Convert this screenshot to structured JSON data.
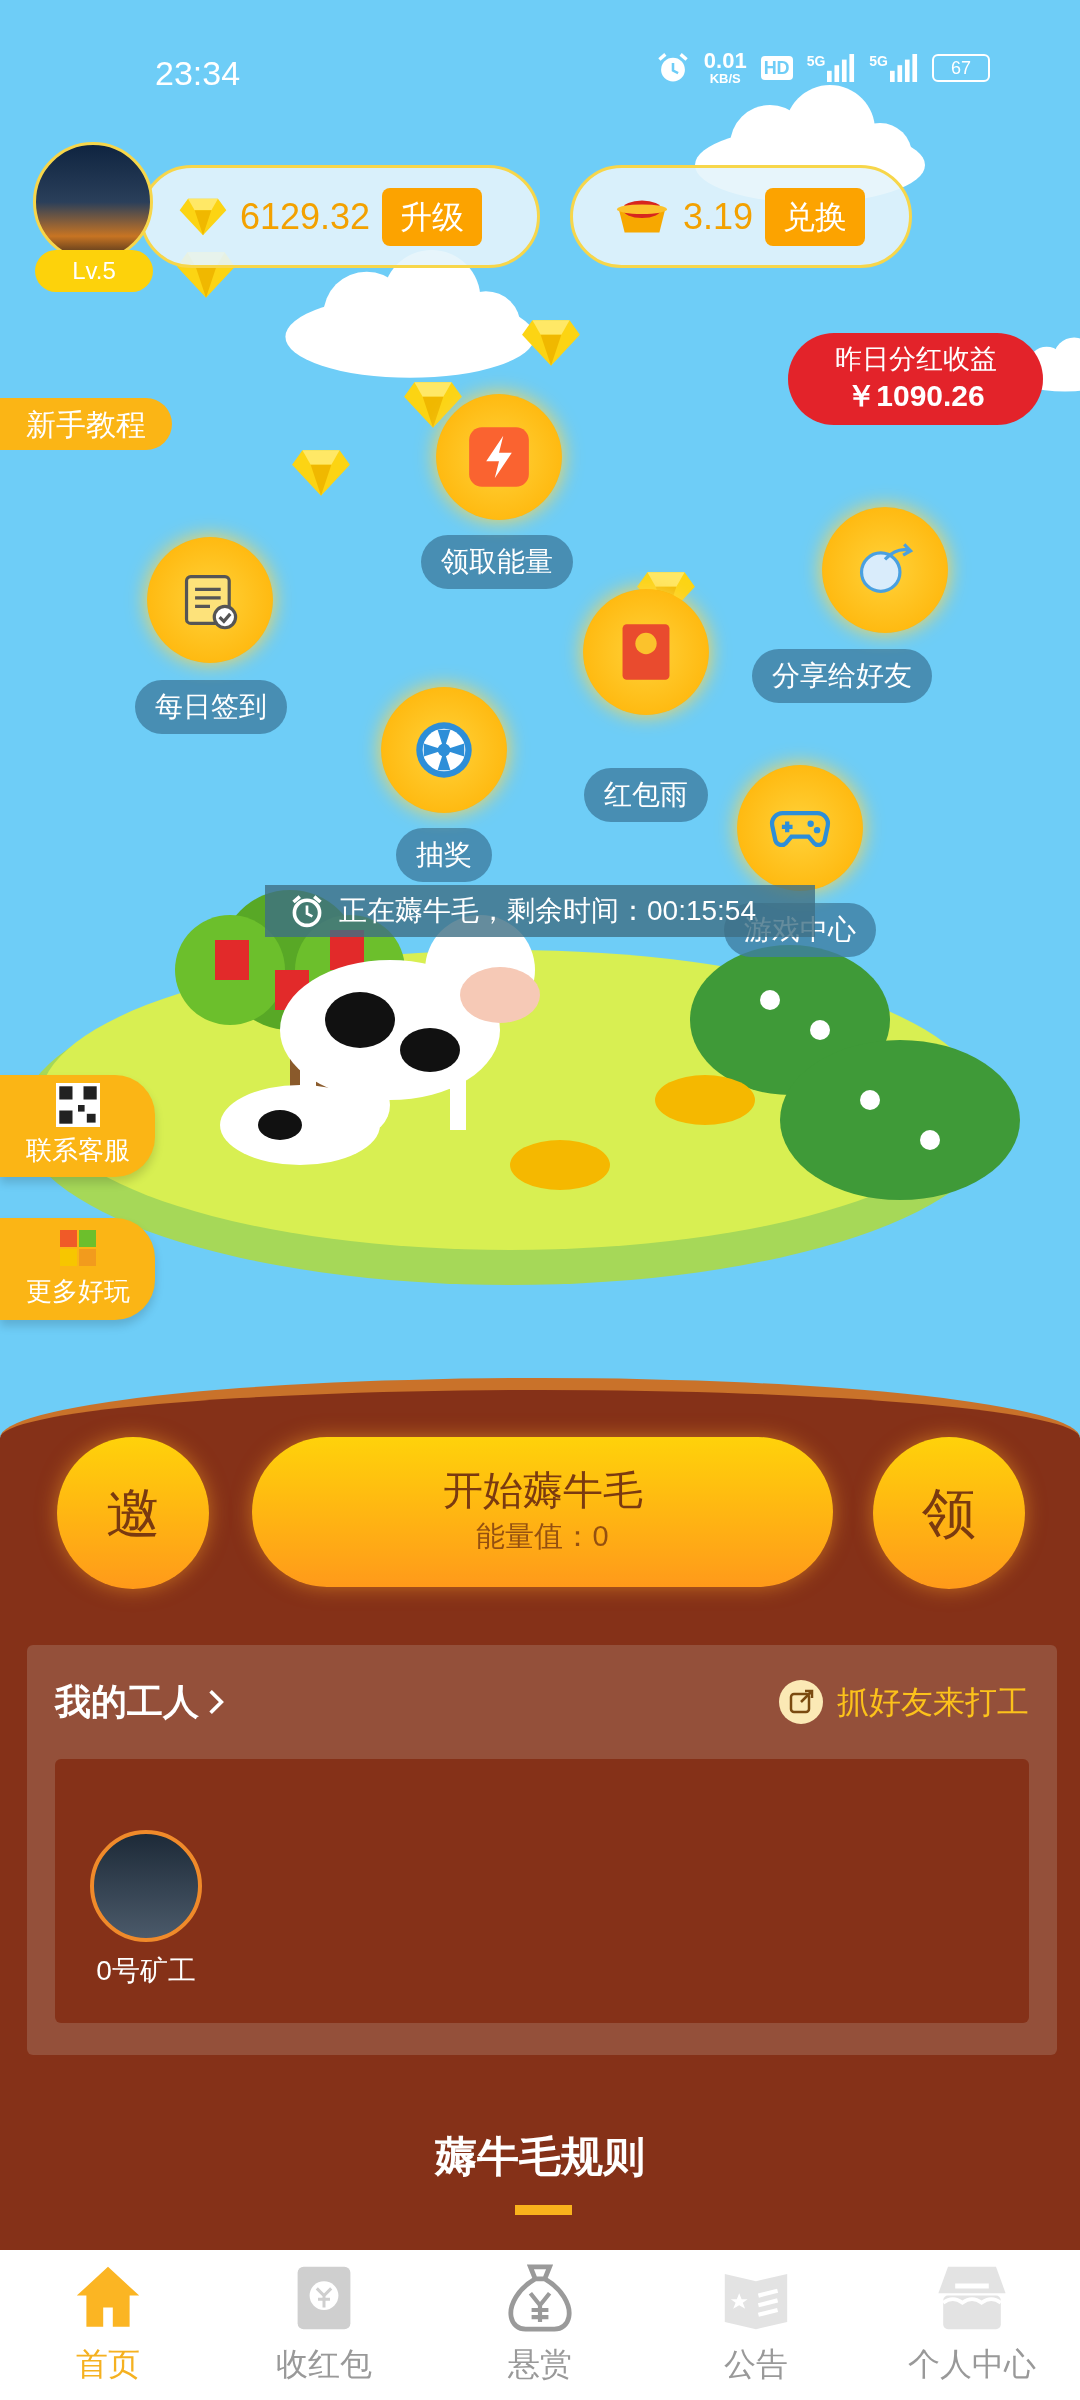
{
  "status_bar": {
    "time": "23:34",
    "speed": "0.01",
    "speed_unit": "KB/S",
    "hd": "HD",
    "networks": [
      "5G",
      "5G"
    ],
    "battery": "67"
  },
  "user": {
    "level": "Lv.5",
    "diamonds": "6129.32",
    "upgrade_button": "升级"
  },
  "ingot": {
    "value": "3.19",
    "exchange_button": "兑换"
  },
  "dividend": {
    "label": "昨日分红收益",
    "amount": "￥1090.26"
  },
  "tutorial_button": "新手教程",
  "features": [
    {
      "kind": "energy",
      "label": "领取能量"
    },
    {
      "kind": "share",
      "label": "分享给好友"
    },
    {
      "kind": "checkin",
      "label": "每日签到"
    },
    {
      "kind": "redpacket",
      "label": "红包雨"
    },
    {
      "kind": "lottery",
      "label": "抽奖"
    },
    {
      "kind": "game",
      "label": "游戏中心"
    }
  ],
  "timer": "正在薅牛毛，剩余时间：00:15:54",
  "side_buttons": [
    {
      "kind": "qr",
      "label": "联系客服"
    },
    {
      "kind": "blocks",
      "label": "更多好玩"
    }
  ],
  "actions": {
    "invite": "邀",
    "start_title": "开始薅牛毛",
    "energy": "能量值：0",
    "claim": "领"
  },
  "workers": {
    "title": "我的工人",
    "invite_link": "抓好友来打工",
    "items": [
      {
        "name": "0号矿工"
      }
    ]
  },
  "rules_title": "薅牛毛规则",
  "nav": [
    {
      "kind": "home",
      "label": "首页",
      "selected": true
    },
    {
      "kind": "envelope",
      "label": "收红包",
      "selected": false
    },
    {
      "kind": "bag",
      "label": "悬赏",
      "selected": false
    },
    {
      "kind": "news",
      "label": "公告",
      "selected": false
    },
    {
      "kind": "shop",
      "label": "个人中心",
      "selected": false
    }
  ]
}
